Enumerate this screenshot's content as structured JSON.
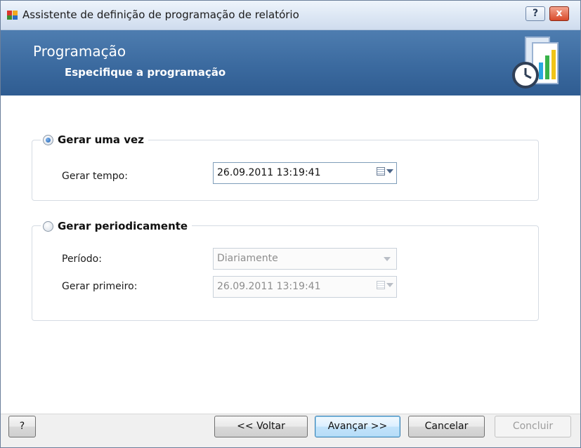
{
  "window": {
    "title": "Assistente de definição de programação de relatório",
    "help_caption": "?",
    "close_caption": "x"
  },
  "header": {
    "title": "Programação",
    "subtitle": "Especifique a programação",
    "icon": "calendar-chart-clock-icon"
  },
  "once_group": {
    "label": "Gerar uma vez",
    "selected": true,
    "time_label": "Gerar tempo:",
    "time_value": "26.09.2011 13:19:41"
  },
  "periodic_group": {
    "label": "Gerar periodicamente",
    "selected": false,
    "period_label": "Período:",
    "period_value": "Diariamente",
    "first_label": "Gerar primeiro:",
    "first_value": "26.09.2011 13:19:41"
  },
  "footer": {
    "help_label": "?",
    "back_label": "<< Voltar",
    "next_label": "Avançar >>",
    "cancel_label": "Cancelar",
    "finish_label": "Concluir"
  },
  "colors": {
    "banner": "#3b6a9f",
    "default_button_border": "#3c7fb1"
  }
}
